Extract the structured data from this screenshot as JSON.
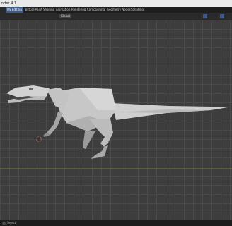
{
  "window": {
    "title": "nder 4.1"
  },
  "workspaces": {
    "tabs": [
      {
        "label": "UV Editing",
        "active": true
      },
      {
        "label": "Texture Paint",
        "active": false
      },
      {
        "label": "Shading",
        "active": false
      },
      {
        "label": "Animation",
        "active": false
      },
      {
        "label": "Rendering",
        "active": false
      },
      {
        "label": "Compositing",
        "active": false
      },
      {
        "label": "Geometry Nodes",
        "active": false
      },
      {
        "label": "Scripting",
        "active": false
      }
    ]
  },
  "header": {
    "orientation_value": "Global",
    "icons": [
      "transform-pivot-icon",
      "snap-icon",
      "proportional-edit-icon",
      "overlay-icon",
      "xray-icon",
      "shading-solid-icon",
      "shading-material-icon",
      "shading-rendered-icon"
    ]
  },
  "viewport": {
    "object": "low-poly dinosaur mesh",
    "grid": true
  },
  "status": {
    "label": "Select"
  },
  "colors": {
    "accent": "#3e5a86",
    "viewport_bg": "#3d3d3d",
    "grid_line": "#4a4a4a",
    "x_axis": "#7a9a3a"
  }
}
